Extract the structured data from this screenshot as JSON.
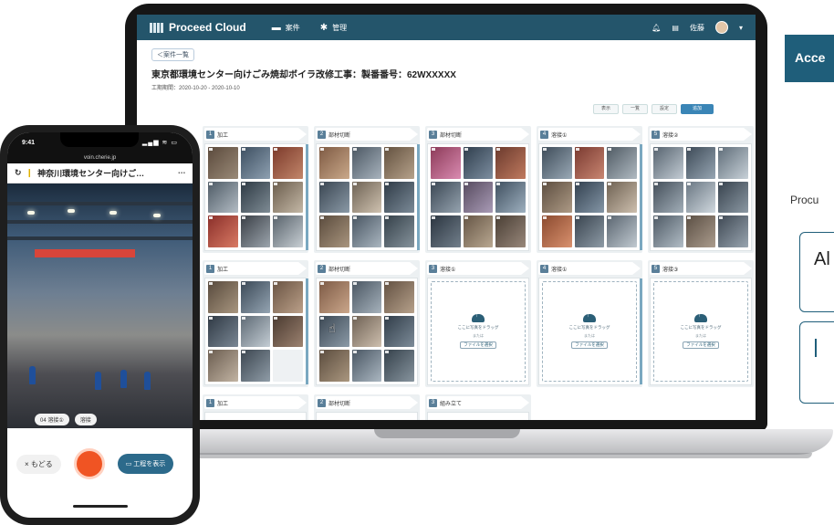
{
  "right_panel": {
    "access_label": "Acce",
    "procu_text": "Procu",
    "box1_text": "Al"
  },
  "app": {
    "name": "Proceed Cloud",
    "nav": [
      "案件",
      "管理"
    ],
    "user": "佐藤"
  },
  "page": {
    "breadcrumb": "＜案件一覧",
    "title": "東京都環境センター向けごみ焼却ボイラ改修工事：製番番号：62WXXXXX",
    "meta": "工期期間：2020-10-20 - 2020-10-10",
    "toolbar": [
      "表示",
      "一覧",
      "設定",
      "追加"
    ]
  },
  "board": {
    "row1": [
      {
        "num": "1",
        "label": "加工"
      },
      {
        "num": "2",
        "label": "部材切断"
      },
      {
        "num": "3",
        "label": "部材切断"
      },
      {
        "num": "4",
        "label": "溶接①"
      },
      {
        "num": "5",
        "label": "溶接②"
      }
    ],
    "row2": [
      {
        "num": "1",
        "label": "加工"
      },
      {
        "num": "2",
        "label": "部材切断"
      },
      {
        "num": "3",
        "label": "溶接①"
      },
      {
        "num": "4",
        "label": "溶接①"
      },
      {
        "num": "5",
        "label": "溶接③"
      }
    ],
    "row3": [
      {
        "num": "1",
        "label": "加工"
      },
      {
        "num": "2",
        "label": "部材切断"
      },
      {
        "num": "3",
        "label": "組み立て"
      }
    ],
    "drop": {
      "text": "ここに写真をドラッグ",
      "sub": "または",
      "button": "ファイルを選択"
    }
  },
  "phone": {
    "time": "9:41",
    "status_icons": "▂▄▆ ≋ ▭",
    "url": "voin.cherie.jp",
    "title": "神奈川環境センター向けご…",
    "chips": [
      "04 溶接①",
      "溶接"
    ],
    "back": "× もどる",
    "process": "▭ 工程を表示"
  }
}
